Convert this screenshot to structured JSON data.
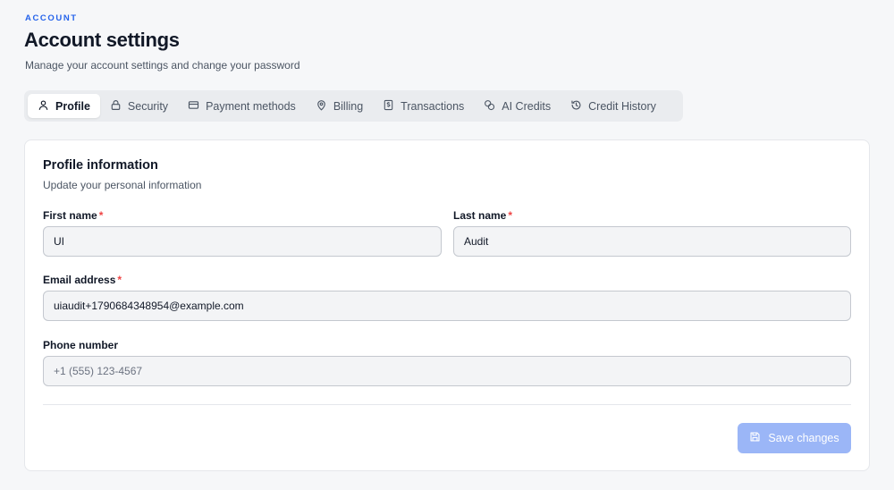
{
  "header": {
    "eyebrow": "ACCOUNT",
    "title": "Account settings",
    "subtitle": "Manage your account settings and change your password"
  },
  "tabs": [
    {
      "label": "Profile",
      "icon": "user-icon",
      "active": true
    },
    {
      "label": "Security",
      "icon": "lock-icon",
      "active": false
    },
    {
      "label": "Payment methods",
      "icon": "credit-card-icon",
      "active": false
    },
    {
      "label": "Billing",
      "icon": "map-pin-icon",
      "active": false
    },
    {
      "label": "Transactions",
      "icon": "receipt-icon",
      "active": false
    },
    {
      "label": "AI Credits",
      "icon": "coins-icon",
      "active": false
    },
    {
      "label": "Credit History",
      "icon": "history-icon",
      "active": false
    }
  ],
  "profile": {
    "title": "Profile information",
    "subtitle": "Update your personal information",
    "required_marker": "*",
    "first_name": {
      "label": "First name",
      "value": "UI"
    },
    "last_name": {
      "label": "Last name",
      "value": "Audit"
    },
    "email": {
      "label": "Email address",
      "value": "uiaudit+1790684348954@example.com"
    },
    "phone": {
      "label": "Phone number",
      "value": "",
      "placeholder": "+1 (555) 123-4567"
    },
    "save_label": "Save changes"
  },
  "colors": {
    "accent": "#2563eb",
    "required": "#ef4444",
    "save_button_disabled": "#9bb6f7"
  }
}
